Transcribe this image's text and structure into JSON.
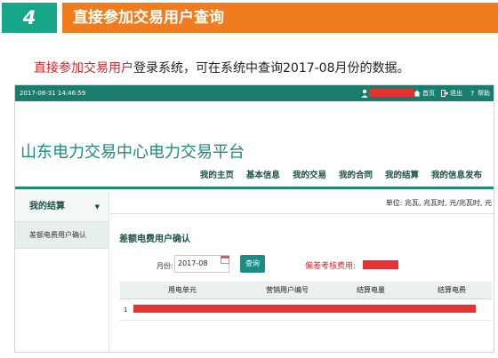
{
  "slide": {
    "step_number": "4",
    "title": "直接参加交易用户查询",
    "intro_highlight": "直接参加交易用户",
    "intro_rest": "登录系统，可在系统中查询2017-08月份的数据。"
  },
  "app": {
    "topbar": {
      "datetime": "2017-08-31 14:46:59",
      "home_label": "首页",
      "logout_label": "退出",
      "help_label": "帮助"
    },
    "brand": "山东电力交易中心电力交易平台",
    "nav": [
      "我的主页",
      "基本信息",
      "我的交易",
      "我的合同",
      "我的结算",
      "我的信息发布"
    ],
    "sidebar": {
      "header": "我的结算",
      "items": [
        "差额电费用户确认"
      ]
    },
    "content": {
      "units": "单位: 兆瓦, 兆瓦时, 元/兆瓦时, 元",
      "section_title": "差额电费用户确认",
      "month_label": "月份:",
      "month_value": "2017-08",
      "query_button": "查询",
      "fee_label": "偏差考核费用:",
      "table": {
        "columns": [
          "用电单元",
          "营销用户编号",
          "结算电量",
          "结算电费"
        ],
        "rows": [
          {
            "index": "1"
          }
        ]
      }
    }
  },
  "colors": {
    "teal": "#17a689",
    "orange": "#f07c1d",
    "dark_teal": "#187d6d",
    "red": "#e53333"
  }
}
